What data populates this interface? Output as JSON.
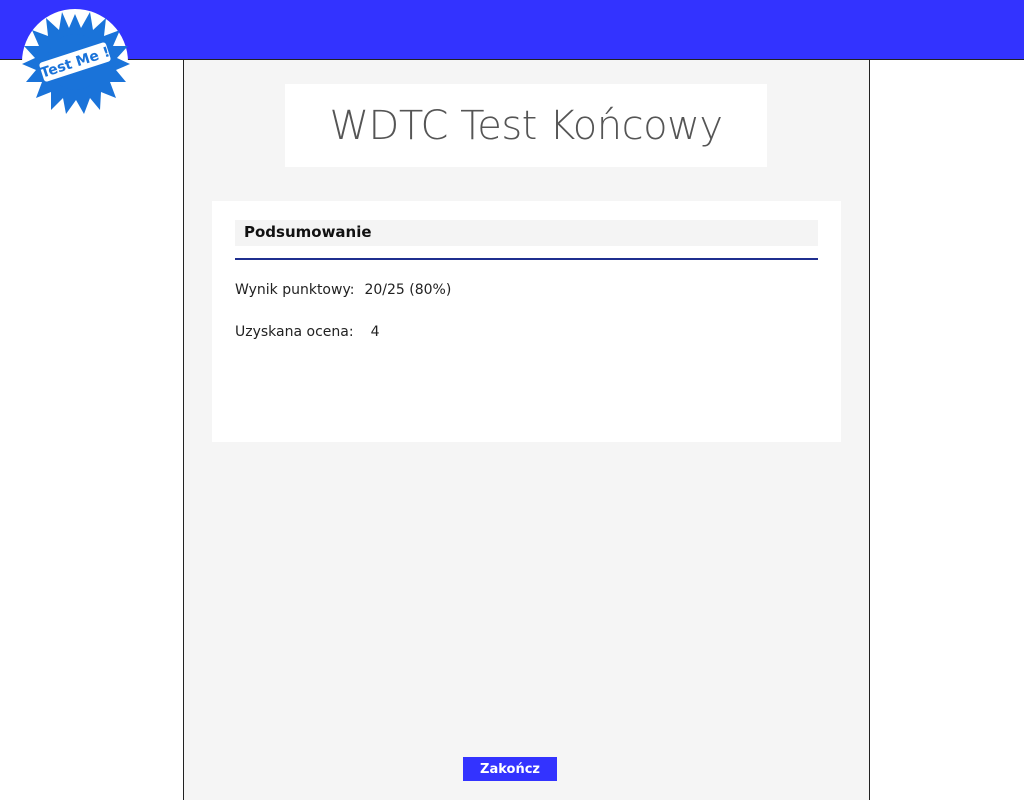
{
  "logo": {
    "text": "Test Me !",
    "icon": "starburst-badge-icon",
    "color": "#1a73d9"
  },
  "header": {
    "background": "#3333ff"
  },
  "test": {
    "title": "WDTC Test Końcowy"
  },
  "summary": {
    "heading": "Podsumowanie",
    "score_label": "Wynik punktowy:",
    "score_value": "20/25 (80%)",
    "grade_label": "Uzyskana ocena:",
    "grade_value": "4"
  },
  "actions": {
    "finish_label": "Zakończ"
  }
}
